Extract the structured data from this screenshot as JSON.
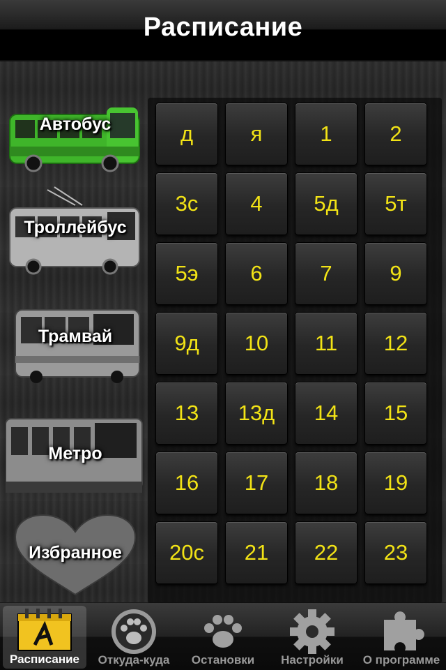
{
  "header": {
    "title": "Расписание"
  },
  "sidebar": {
    "items": [
      {
        "label": "Автобус",
        "icon": "bus-icon",
        "color": "#3fb52a"
      },
      {
        "label": "Троллейбус",
        "icon": "trolleybus-icon"
      },
      {
        "label": "Трамвай",
        "icon": "tram-icon"
      },
      {
        "label": "Метро",
        "icon": "metro-icon"
      },
      {
        "label": "Избранное",
        "icon": "heart-icon"
      }
    ]
  },
  "routes": {
    "buttons": [
      "д",
      "я",
      "1",
      "2",
      "3с",
      "4",
      "5д",
      "5т",
      "5э",
      "6",
      "7",
      "9",
      "9д",
      "10",
      "11",
      "12",
      "13",
      "13д",
      "14",
      "15",
      "16",
      "17",
      "18",
      "19",
      "20с",
      "21",
      "22",
      "23"
    ],
    "text_color": "#f2e316"
  },
  "tabbar": {
    "tabs": [
      {
        "label": "Расписание",
        "icon": "schedule-calendar-icon",
        "selected": true
      },
      {
        "label": "Откуда-куда",
        "icon": "paw-circle-icon",
        "selected": false
      },
      {
        "label": "Остановки",
        "icon": "paw-icon",
        "selected": false
      },
      {
        "label": "Настройки",
        "icon": "gear-icon",
        "selected": false
      },
      {
        "label": "О программе",
        "icon": "puzzle-icon",
        "selected": false
      }
    ]
  }
}
